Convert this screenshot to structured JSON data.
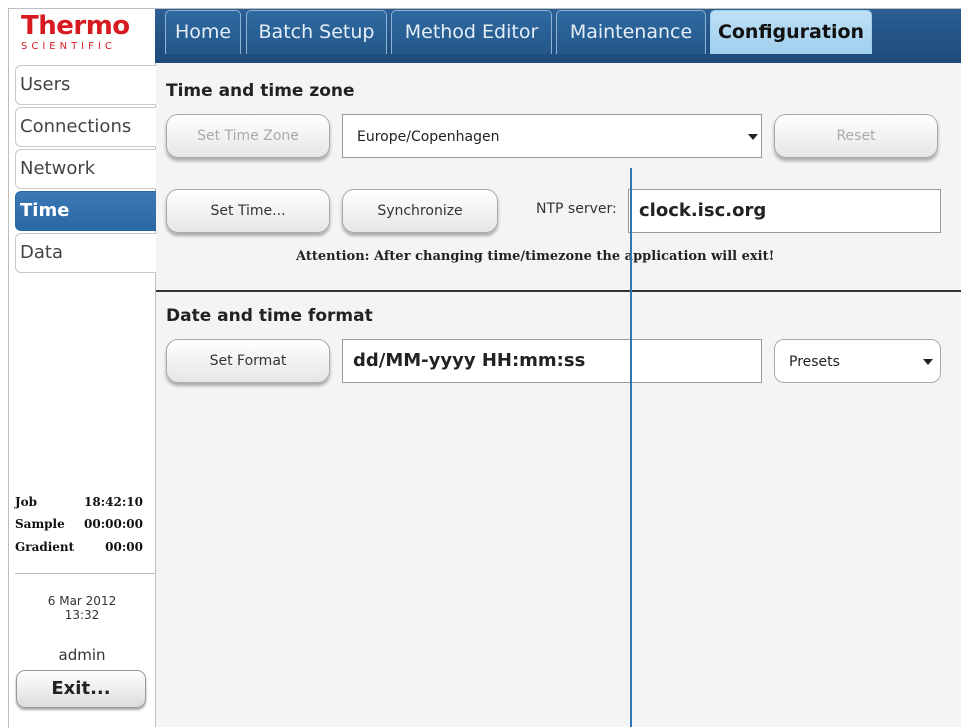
{
  "logo": {
    "main": "Thermo",
    "sub": "SCIENTIFIC"
  },
  "tabs": [
    "Home",
    "Batch Setup",
    "Method Editor",
    "Maintenance",
    "Configuration"
  ],
  "sidebar": {
    "items": [
      "Users",
      "Connections",
      "Network",
      "Time",
      "Data"
    ],
    "status": [
      {
        "label": "Job",
        "value": "18:42:10"
      },
      {
        "label": "Sample",
        "value": "00:00:00"
      },
      {
        "label": "Gradient",
        "value": "00:00"
      }
    ],
    "date": "6 Mar 2012",
    "time": "13:32",
    "user": "admin",
    "exit_label": "Exit..."
  },
  "time_section": {
    "title": "Time and time zone",
    "set_time_zone": "Set Time Zone",
    "timezone_value": "Europe/Copenhagen",
    "reset": "Reset",
    "set_time": "Set Time...",
    "synchronize": "Synchronize",
    "ntp_label": "NTP server:",
    "ntp_value": "clock.isc.org",
    "attention": "Attention: After changing time/timezone the application will exit!"
  },
  "format_section": {
    "title": "Date and time format",
    "set_format": "Set Format",
    "format_value": "dd/MM-yyyy HH:mm:ss",
    "presets": "Presets"
  },
  "colors": {
    "brand_red": "#d71920",
    "nav_blue": "#2c5f93",
    "active_tab": "#bfe0f5",
    "active_side": "#2a67a5"
  }
}
